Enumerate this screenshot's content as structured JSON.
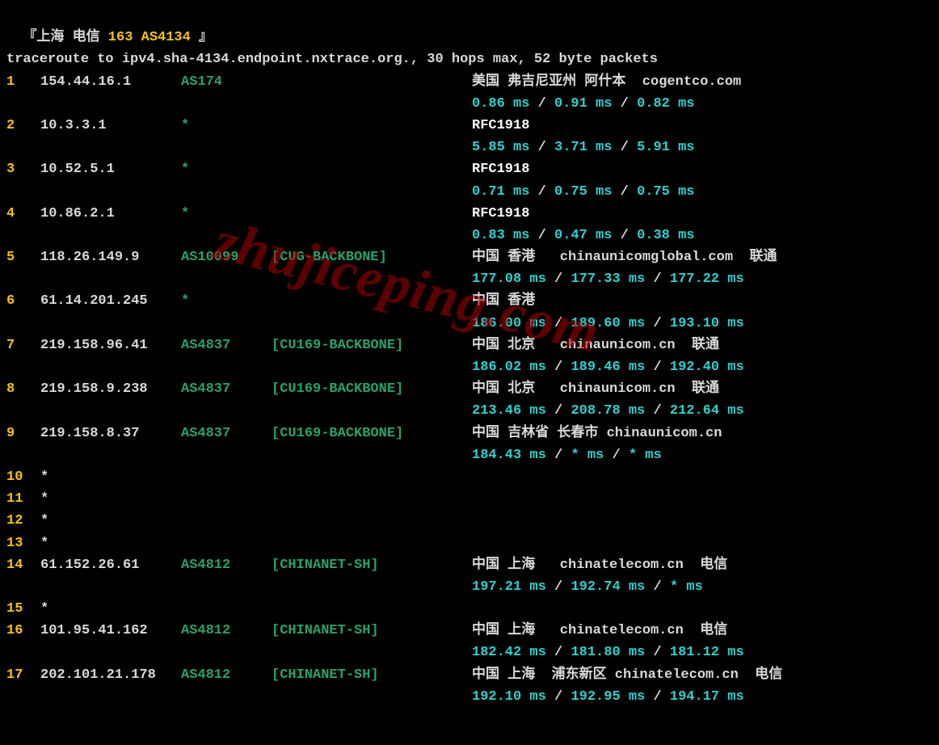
{
  "header": {
    "bracket_open": "『",
    "bracket_close": " 』",
    "loc": "上海 电信",
    "net": " 163 AS4134"
  },
  "intro": "traceroute to ipv4.sha-4134.endpoint.nxtrace.org., 30 hops max, 52 byte packets",
  "watermark": "zhujiceping.com",
  "hops": [
    {
      "n": "1",
      "ip": "154.44.16.1",
      "asn": "AS174",
      "tag": "",
      "geo": "美国 弗吉尼亚州 阿什本  cogentco.com",
      "t1": "0.86 ms",
      "t2": "0.91 ms",
      "t3": "0.82 ms"
    },
    {
      "n": "2",
      "ip": "10.3.3.1",
      "asn": "*",
      "tag": "",
      "geo_white": "RFC1918",
      "t1": "5.85 ms",
      "t2": "3.71 ms",
      "t3": "5.91 ms"
    },
    {
      "n": "3",
      "ip": "10.52.5.1",
      "asn": "*",
      "tag": "",
      "geo_white": "RFC1918",
      "t1": "0.71 ms",
      "t2": "0.75 ms",
      "t3": "0.75 ms"
    },
    {
      "n": "4",
      "ip": "10.86.2.1",
      "asn": "*",
      "tag": "",
      "geo_white": "RFC1918",
      "t1": "0.83 ms",
      "t2": "0.47 ms",
      "t3": "0.38 ms"
    },
    {
      "n": "5",
      "ip": "118.26.149.9",
      "asn": "AS10099",
      "tag": "[CUG-BACKBONE]",
      "geo": "中国 香港   chinaunicomglobal.com  联通",
      "t1": "177.08 ms",
      "t2": "177.33 ms",
      "t3": "177.22 ms"
    },
    {
      "n": "6",
      "ip": "61.14.201.245",
      "asn": "*",
      "tag": "",
      "geo": "中国 香港",
      "t1": "186.00 ms",
      "t2": "189.60 ms",
      "t3": "193.10 ms"
    },
    {
      "n": "7",
      "ip": "219.158.96.41",
      "asn": "AS4837",
      "tag": "[CU169-BACKBONE]",
      "geo": "中国 北京   chinaunicom.cn  联通",
      "t1": "186.02 ms",
      "t2": "189.46 ms",
      "t3": "192.40 ms"
    },
    {
      "n": "8",
      "ip": "219.158.9.238",
      "asn": "AS4837",
      "tag": "[CU169-BACKBONE]",
      "geo": "中国 北京   chinaunicom.cn  联通",
      "t1": "213.46 ms",
      "t2": "208.78 ms",
      "t3": "212.64 ms"
    },
    {
      "n": "9",
      "ip": "219.158.8.37",
      "asn": "AS4837",
      "tag": "[CU169-BACKBONE]",
      "geo": "中国 吉林省 长春市 chinaunicom.cn",
      "t1": "184.43 ms",
      "t2": "* ms",
      "t3": "* ms"
    },
    {
      "n": "10",
      "ip": "*",
      "nolat": true
    },
    {
      "n": "11",
      "ip": "*",
      "nolat": true
    },
    {
      "n": "12",
      "ip": "*",
      "nolat": true
    },
    {
      "n": "13",
      "ip": "*",
      "nolat": true
    },
    {
      "n": "14",
      "ip": "61.152.26.61",
      "asn": "AS4812",
      "tag": "[CHINANET-SH]",
      "geo": "中国 上海   chinatelecom.cn  电信",
      "t1": "197.21 ms",
      "t2": "192.74 ms",
      "t3": "* ms"
    },
    {
      "n": "15",
      "ip": "*",
      "nolat": true
    },
    {
      "n": "16",
      "ip": "101.95.41.162",
      "asn": "AS4812",
      "tag": "[CHINANET-SH]",
      "geo": "中国 上海   chinatelecom.cn  电信",
      "t1": "182.42 ms",
      "t2": "181.80 ms",
      "t3": "181.12 ms"
    },
    {
      "n": "17",
      "ip": "202.101.21.178",
      "asn": "AS4812",
      "tag": "[CHINANET-SH]",
      "geo": "中国 上海  浦东新区 chinatelecom.cn  电信",
      "t1": "192.10 ms",
      "t2": "192.95 ms",
      "t3": "194.17 ms"
    }
  ]
}
